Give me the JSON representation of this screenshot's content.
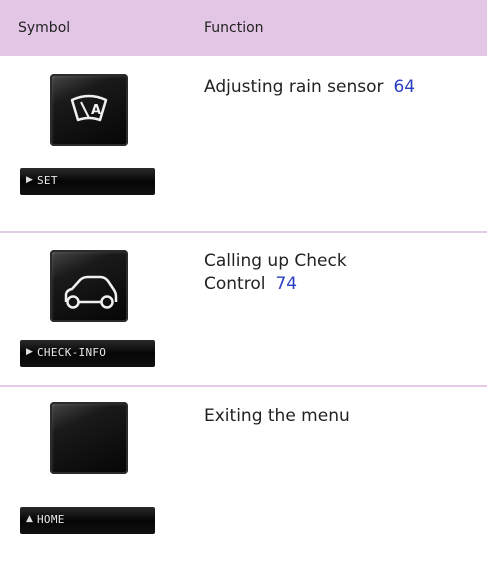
{
  "header": {
    "symbol_label": "Symbol",
    "function_label": "Function"
  },
  "rows": [
    {
      "icon": "windshield-wiper-auto-icon",
      "softkey": "SET",
      "softkey_arrow": "right",
      "function": "Adjusting rain sensor",
      "page": "64"
    },
    {
      "icon": "car-icon",
      "softkey": "CHECK-INFO",
      "softkey_arrow": "right",
      "function_line1": "Calling up Check",
      "function_line2": "Control",
      "page": "74"
    },
    {
      "icon": "blank-button-icon",
      "softkey": "HOME",
      "softkey_arrow": "up",
      "function": "Exiting the menu"
    }
  ],
  "colors": {
    "header_bg": "#e3c6e6",
    "divider": "#e6c9e6",
    "page_ref": "#2a3fc4"
  }
}
